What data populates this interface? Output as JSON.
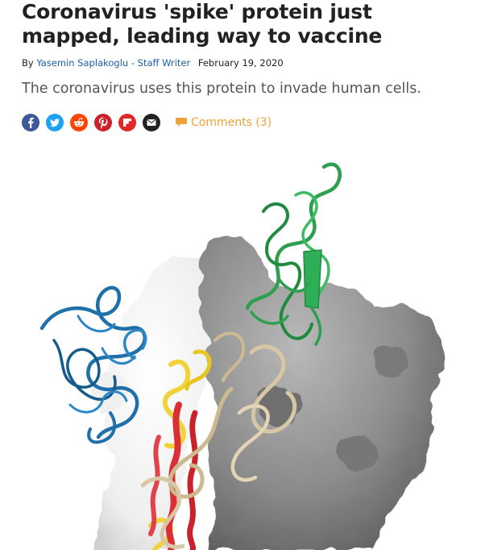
{
  "article": {
    "headline": "Coronavirus 'spike' protein just mapped, leading way to vaccine",
    "byline_prefix": "By",
    "author": "Yasemin Saplakoglu - Staff Writer",
    "date": "February 19, 2020",
    "subhead": "The coronavirus uses this protein to invade human cells."
  },
  "share": {
    "buttons": [
      {
        "icon": "facebook-icon",
        "color": "#3b5998"
      },
      {
        "icon": "twitter-icon",
        "color": "#1da1f2"
      },
      {
        "icon": "reddit-icon",
        "color": "#ff4500"
      },
      {
        "icon": "pinterest-icon",
        "color": "#cb2027"
      },
      {
        "icon": "flipboard-icon",
        "color": "#e12828"
      },
      {
        "icon": "email-icon",
        "color": "#222222"
      }
    ],
    "comments_label": "Comments (3)",
    "comments_color": "#f0a23a"
  },
  "image": {
    "subject": "spike-protein-structure",
    "colors": {
      "surface_gray": "#8a8a8a",
      "surface_white": "#f4f4f4",
      "ribbon_green": "#2e9e4f",
      "ribbon_blue": "#1f6fa8",
      "ribbon_yellow": "#f2d23a",
      "ribbon_red": "#d92f35",
      "ribbon_tan": "#d8c7a4"
    }
  }
}
